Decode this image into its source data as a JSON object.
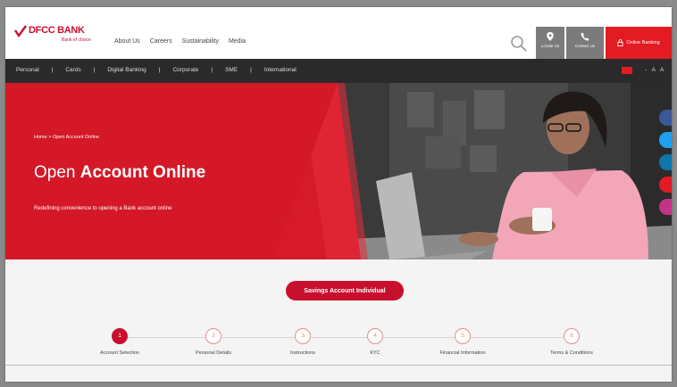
{
  "header": {
    "brand": "DFCC BANK",
    "tagline": "Bank of choice",
    "nav": [
      "About Us",
      "Careers",
      "Sustainability",
      "Media"
    ],
    "locate_us": "Locate Us",
    "contact_us": "Contact Us",
    "online_banking": "Online Banking"
  },
  "menu": {
    "items": [
      "Personal",
      "Cards",
      "Digital Banking",
      "Corporate",
      "SME",
      "International"
    ],
    "font_size_controls": "- A A"
  },
  "hero": {
    "breadcrumb": "Home  >  Open Account Online",
    "title_light": "Open ",
    "title_bold": "Account Online",
    "subtitle": "Redefining convenience to opening a Bank account online"
  },
  "content": {
    "account_type_button": "Savings Account Individual",
    "steps": [
      {
        "number": "1",
        "label": "Account Selection",
        "active": true
      },
      {
        "number": "2",
        "label": "Personal Details",
        "active": false
      },
      {
        "number": "3",
        "label": "Instructions",
        "active": false
      },
      {
        "number": "4",
        "label": "KYC",
        "active": false
      },
      {
        "number": "5",
        "label": "Financial Information",
        "active": false
      },
      {
        "number": "6",
        "label": "Terms & Conditions",
        "active": false
      }
    ]
  },
  "social_icons": [
    "facebook-icon",
    "twitter-icon",
    "linkedin-icon",
    "youtube-icon",
    "instagram-icon"
  ],
  "colors": {
    "brand_red": "#c8102e",
    "accent_red": "#e31b23",
    "dark_nav": "#2a2a2a",
    "utility_gray": "#7b7b7b"
  }
}
